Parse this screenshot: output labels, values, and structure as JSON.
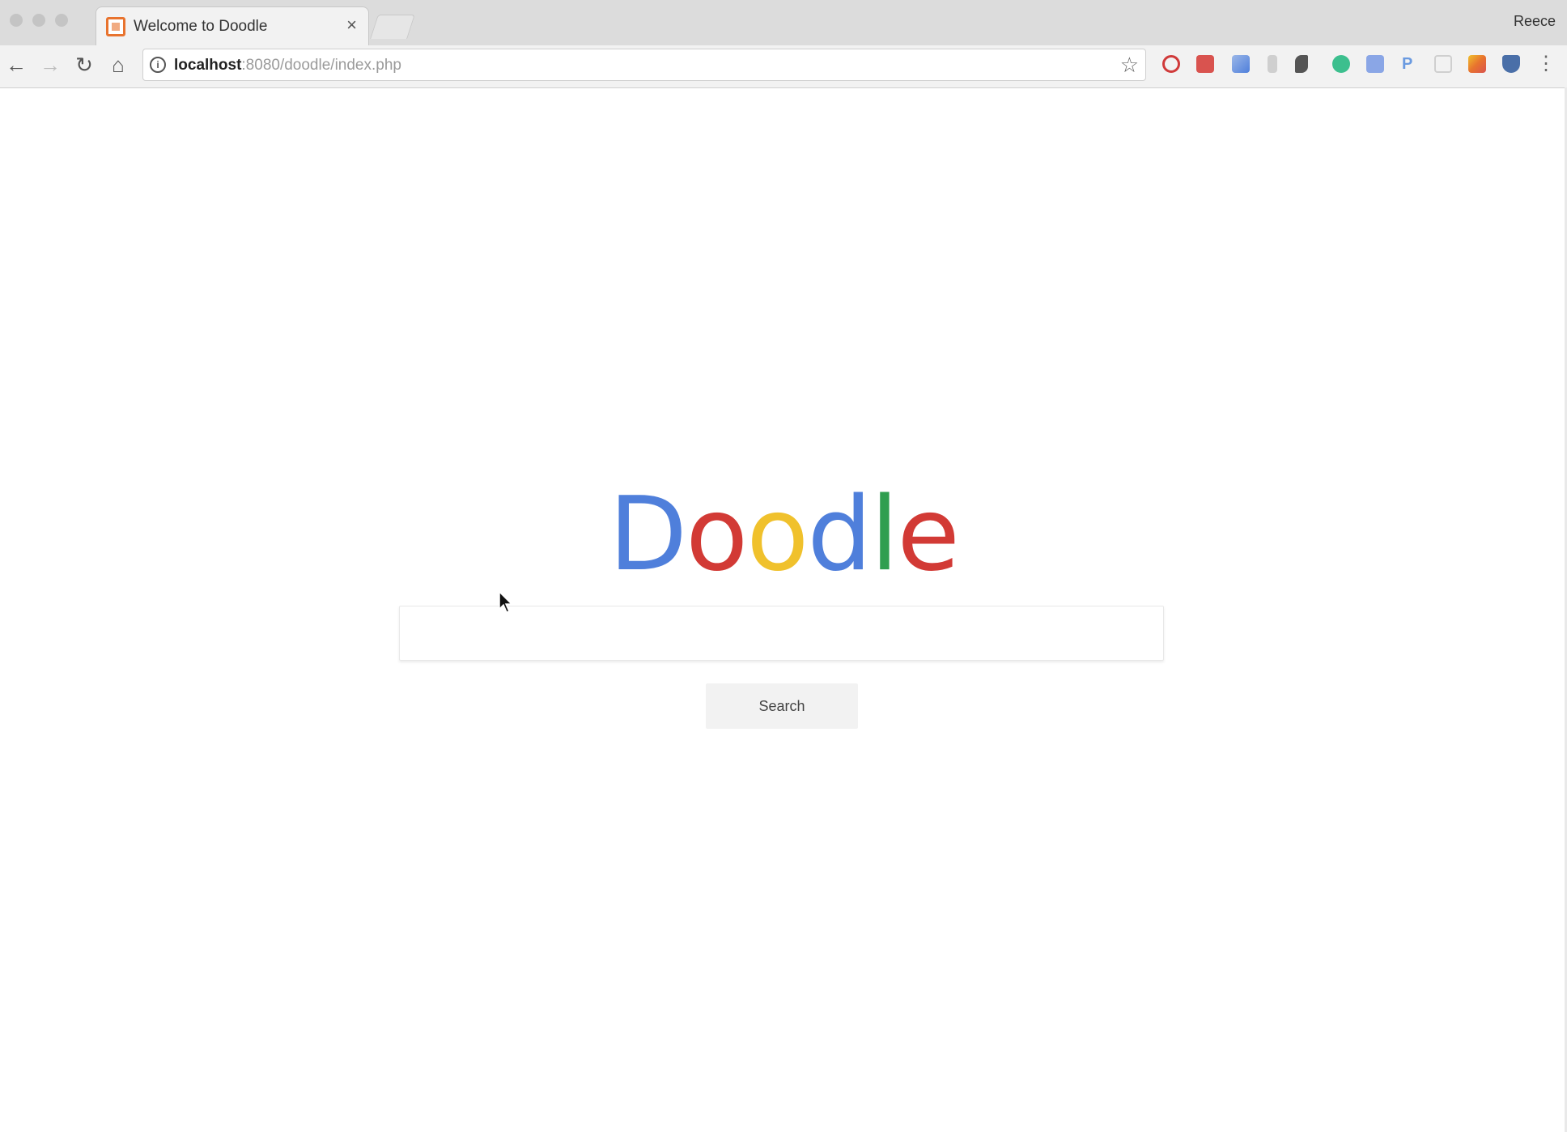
{
  "browser": {
    "tab": {
      "title": "Welcome to Doodle",
      "close_glyph": "×",
      "favicon": "doodle-favicon"
    },
    "profile_name": "Reece",
    "url": {
      "host": "localhost",
      "path": ":8080/doodle/index.php"
    },
    "nav": {
      "back_glyph": "←",
      "forward_glyph": "→",
      "reload_glyph": "↻",
      "home_glyph": "⌂",
      "info_glyph": "i",
      "star_glyph": "☆",
      "menu_glyph": "⋮"
    },
    "extensions": [
      "opera-icon",
      "stop-icon",
      "translate-ext-icon",
      "ext-grey-icon",
      "ext-dark-icon",
      "grammarly-icon",
      "translate-icon",
      "paypal-icon",
      "ext-box-icon",
      "ext-color-icon",
      "shield-icon"
    ],
    "colors": {
      "favicon_orange": "#e8732e"
    }
  },
  "page": {
    "logo": {
      "letters": [
        "D",
        "o",
        "o",
        "d",
        "l",
        "e"
      ],
      "colors": [
        "#4f7fdb",
        "#d23a35",
        "#f0c12c",
        "#4f7fdb",
        "#2f9e4f",
        "#d23a35"
      ]
    },
    "search": {
      "value": "",
      "placeholder": "",
      "button_label": "Search"
    }
  }
}
